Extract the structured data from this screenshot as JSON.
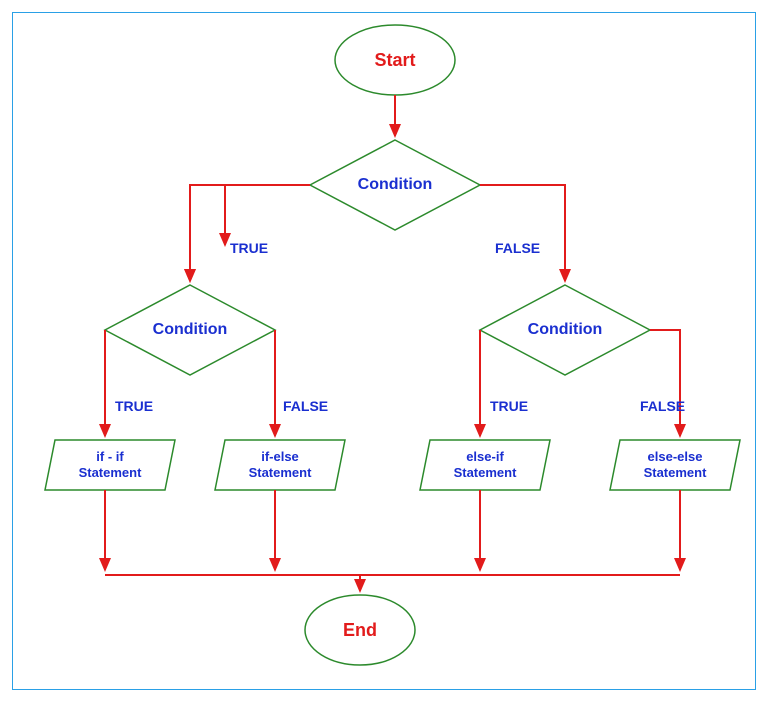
{
  "flowchart": {
    "start": "Start",
    "end": "End",
    "condition_top": "Condition",
    "condition_left": "Condition",
    "condition_right": "Condition",
    "branch_true": "TRUE",
    "branch_false": "FALSE",
    "stmt_if_if_l1": "if - if",
    "stmt_if_if_l2": "Statement",
    "stmt_if_else_l1": "if-else",
    "stmt_if_else_l2": "Statement",
    "stmt_else_if_l1": "else-if",
    "stmt_else_if_l2": "Statement",
    "stmt_else_else_l1": "else-else",
    "stmt_else_else_l2": "Statement"
  },
  "colors": {
    "border": "#2aa0e6",
    "shape": "#2c8a2c",
    "arrow": "#e21b1b",
    "label": "#1a2fd0"
  }
}
